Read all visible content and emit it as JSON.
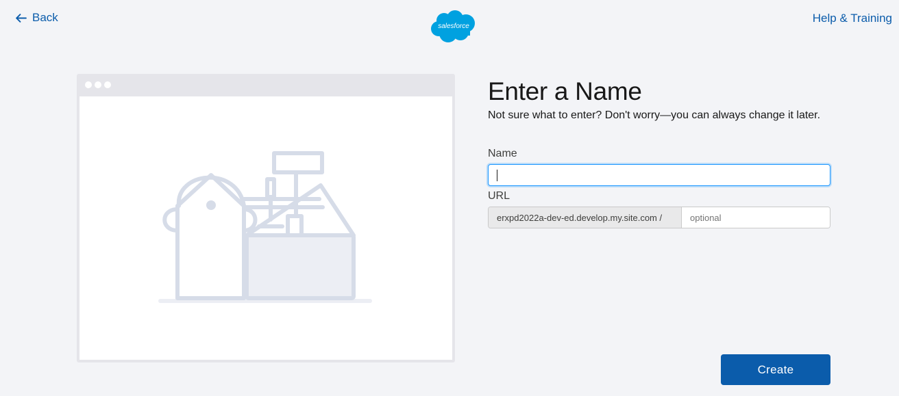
{
  "nav": {
    "back_label": "Back",
    "help_label": "Help & Training"
  },
  "logo": {
    "text": "salesforce",
    "color": "#00a1e0"
  },
  "form": {
    "title": "Enter a Name",
    "subtitle": "Not sure what to enter? Don't worry—you can always change it later.",
    "name_label": "Name",
    "name_value": "",
    "url_label": "URL",
    "url_prefix": "erxpd2022a-dev-ed.develop.my.site.com /",
    "url_placeholder": "optional",
    "url_value": ""
  },
  "actions": {
    "create_label": "Create"
  },
  "colors": {
    "accent": "#0b5cab",
    "focus": "#1b96ff",
    "background": "#f3f4f7",
    "illustration": "#d8dde9"
  }
}
